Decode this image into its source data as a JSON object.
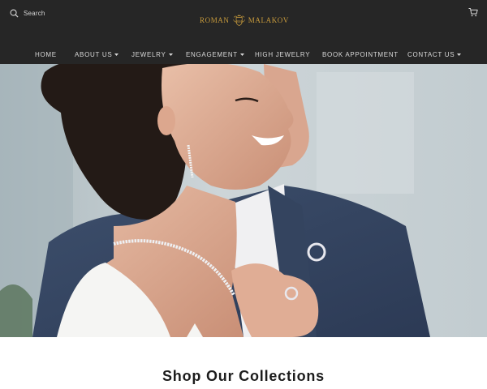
{
  "header": {
    "search_label": "Search",
    "search_icon": "search-icon",
    "brand_left": "Roman",
    "brand_right": "Malakov",
    "brand_crest_icon": "crest-icon",
    "cart_icon": "cart-icon",
    "brand_color": "#c89b3c",
    "background": "#262626"
  },
  "nav": {
    "items": [
      {
        "label": "HOME",
        "has_dropdown": false
      },
      {
        "label": "ABOUT US",
        "has_dropdown": true
      },
      {
        "label": "JEWELRY",
        "has_dropdown": true
      },
      {
        "label": "ENGAGEMENT",
        "has_dropdown": true
      },
      {
        "label": "HIGH JEWELRY",
        "has_dropdown": false
      },
      {
        "label": "BOOK APPOINTMENT",
        "has_dropdown": false
      },
      {
        "label": "CONTACT US",
        "has_dropdown": true
      }
    ],
    "dropdown_icon": "caret-down-icon"
  },
  "hero": {
    "image": "hero-image"
  },
  "collections": {
    "title": "Shop Our Collections"
  }
}
